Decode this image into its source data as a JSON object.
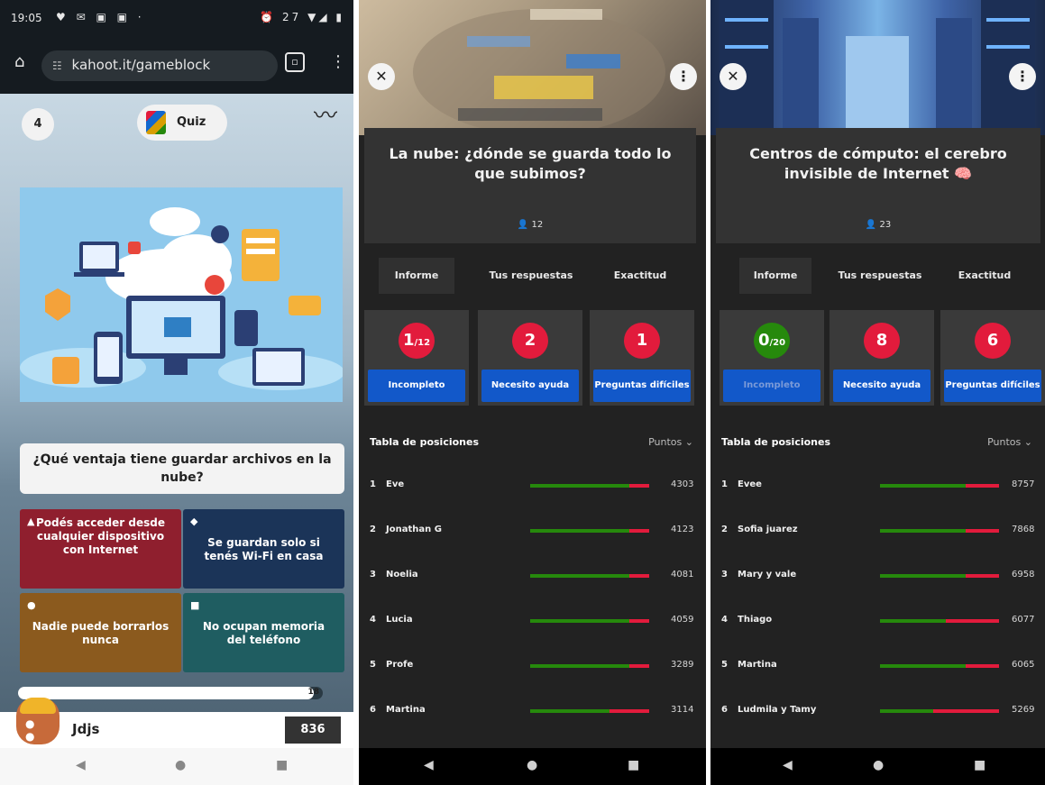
{
  "game": {
    "status": {
      "time": "19:05",
      "icons_left": "♥ ✉ ▣ ▣ ·",
      "icons_right": "⏰ 27 ▼◢ ▮"
    },
    "browser": {
      "url": "kahoot.it/gameblock"
    },
    "question_number": "4",
    "mode": "Quiz",
    "question": "¿Qué ventaja tiene guardar archivos en la nube?",
    "answers": [
      {
        "shape": "▲",
        "text": "Podés acceder desde cualquier dispositivo con Internet"
      },
      {
        "shape": "◆",
        "text": "Se guardan solo si tenés Wi-Fi en casa"
      },
      {
        "shape": "●",
        "text": "Nadie puede borrarlos nunca"
      },
      {
        "shape": "■",
        "text": "No ocupan memoria del teléfono"
      }
    ],
    "timer_value": "18",
    "timer_fraction": 0.97,
    "player_name": "Jdjs",
    "player_score": "836"
  },
  "report1": {
    "title": "La nube: ¿dónde se guarda todo lo que subimos?",
    "players": "12",
    "tabs": [
      "Informe",
      "Tus respuestas",
      "Exactitud"
    ],
    "cards": [
      {
        "value": "1",
        "suffix": "/12",
        "label": "Incompleto",
        "color": "#e21b3c"
      },
      {
        "value": "2",
        "suffix": "",
        "label": "Necesito ayuda",
        "color": "#e21b3c"
      },
      {
        "value": "1",
        "suffix": "",
        "label": "Preguntas difíciles",
        "color": "#e21b3c"
      }
    ],
    "leaderboard_title": "Tabla de posiciones",
    "sort_label": "Puntos",
    "rows": [
      {
        "rank": "1",
        "name": "Eve",
        "points": "4303",
        "correct": 0.83
      },
      {
        "rank": "2",
        "name": "Jonathan G",
        "points": "4123",
        "correct": 0.83
      },
      {
        "rank": "3",
        "name": "Noelia",
        "points": "4081",
        "correct": 0.83
      },
      {
        "rank": "4",
        "name": "Lucia",
        "points": "4059",
        "correct": 0.83
      },
      {
        "rank": "5",
        "name": "Profe",
        "points": "3289",
        "correct": 0.83
      },
      {
        "rank": "6",
        "name": "Martina",
        "points": "3114",
        "correct": 0.67
      }
    ]
  },
  "report2": {
    "title": "Centros de cómputo: el cerebro invisible de Internet 🧠",
    "players": "23",
    "tabs": [
      "Informe",
      "Tus respuestas",
      "Exactitud"
    ],
    "cards": [
      {
        "value": "0",
        "suffix": "/20",
        "label": "Incompleto",
        "color": "#26890c"
      },
      {
        "value": "8",
        "suffix": "",
        "label": "Necesito ayuda",
        "color": "#e21b3c"
      },
      {
        "value": "6",
        "suffix": "",
        "label": "Preguntas difíciles",
        "color": "#e21b3c"
      }
    ],
    "leaderboard_title": "Tabla de posiciones",
    "sort_label": "Puntos",
    "rows": [
      {
        "rank": "1",
        "name": "Evee",
        "points": "8757",
        "correct": 0.72
      },
      {
        "rank": "2",
        "name": "Sofia juarez",
        "points": "7868",
        "correct": 0.72
      },
      {
        "rank": "3",
        "name": "Mary y vale",
        "points": "6958",
        "correct": 0.72
      },
      {
        "rank": "4",
        "name": "Thiago",
        "points": "6077",
        "correct": 0.55
      },
      {
        "rank": "5",
        "name": "Martina",
        "points": "6065",
        "correct": 0.72
      },
      {
        "rank": "6",
        "name": "Ludmila y Tamy",
        "points": "5269",
        "correct": 0.45
      }
    ]
  },
  "nav": {
    "back": "◀",
    "home": "●",
    "recents": "■"
  }
}
